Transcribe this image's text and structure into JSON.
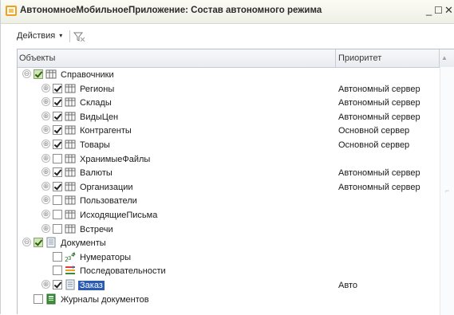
{
  "window": {
    "title": "АвтономноеМобильноеПриложение: Состав автономного режима",
    "minimize": "_",
    "maximize": "☐",
    "close": "✕"
  },
  "toolbar": {
    "actions_label": "Действия",
    "actions_caret": "▾"
  },
  "grid": {
    "columns": {
      "objects": "Объекты",
      "priority": "Приоритет"
    },
    "sort_indicator": "▲",
    "rows": [
      {
        "label": "Справочники",
        "priority": "",
        "check": "partial",
        "toggle": "⊖",
        "icon": "table-icon",
        "level": 0
      },
      {
        "label": "Регионы",
        "priority": "Автономный сервер",
        "check": "checked",
        "toggle": "⊕",
        "icon": "table-icon",
        "level": 1
      },
      {
        "label": "Склады",
        "priority": "Автономный сервер",
        "check": "checked",
        "toggle": "⊕",
        "icon": "table-icon",
        "level": 1
      },
      {
        "label": "ВидыЦен",
        "priority": "Автономный сервер",
        "check": "checked",
        "toggle": "⊕",
        "icon": "table-icon",
        "level": 1
      },
      {
        "label": "Контрагенты",
        "priority": "Основной сервер",
        "check": "checked",
        "toggle": "⊕",
        "icon": "table-icon",
        "level": 1
      },
      {
        "label": "Товары",
        "priority": "Основной сервер",
        "check": "checked",
        "toggle": "⊕",
        "icon": "table-icon",
        "level": 1
      },
      {
        "label": "ХранимыеФайлы",
        "priority": "",
        "check": "unchecked",
        "toggle": "⊕",
        "icon": "table-icon",
        "level": 1
      },
      {
        "label": "Валюты",
        "priority": "Автономный сервер",
        "check": "checked",
        "toggle": "⊕",
        "icon": "table-icon",
        "level": 1
      },
      {
        "label": "Организации",
        "priority": "Автономный сервер",
        "check": "checked",
        "toggle": "⊕",
        "icon": "table-icon",
        "level": 1
      },
      {
        "label": "Пользователи",
        "priority": "",
        "check": "unchecked",
        "toggle": "⊕",
        "icon": "table-icon",
        "level": 1
      },
      {
        "label": "ИсходящиеПисьма",
        "priority": "",
        "check": "unchecked",
        "toggle": "⊕",
        "icon": "table-icon",
        "level": 1
      },
      {
        "label": "Встречи",
        "priority": "",
        "check": "unchecked",
        "toggle": "⊕",
        "icon": "table-icon",
        "level": 1
      },
      {
        "label": "Документы",
        "priority": "",
        "check": "partial",
        "toggle": "⊖",
        "icon": "document-icon",
        "level": 0
      },
      {
        "label": "Нумераторы",
        "priority": "",
        "check": "unchecked",
        "toggle": "",
        "icon": "numerator-icon",
        "level": 1
      },
      {
        "label": "Последовательности",
        "priority": "",
        "check": "unchecked",
        "toggle": "",
        "icon": "sequence-icon",
        "level": 1
      },
      {
        "label": "Заказ",
        "priority": "Авто",
        "check": "checked",
        "toggle": "⊕",
        "icon": "document-icon",
        "level": 1,
        "selected": true
      },
      {
        "label": "Журналы документов",
        "priority": "",
        "check": "unchecked",
        "toggle": "",
        "icon": "journal-icon",
        "level": 0
      }
    ]
  },
  "colors": {
    "selection": "#2b5bb0",
    "app_icon": "#f0a020"
  }
}
